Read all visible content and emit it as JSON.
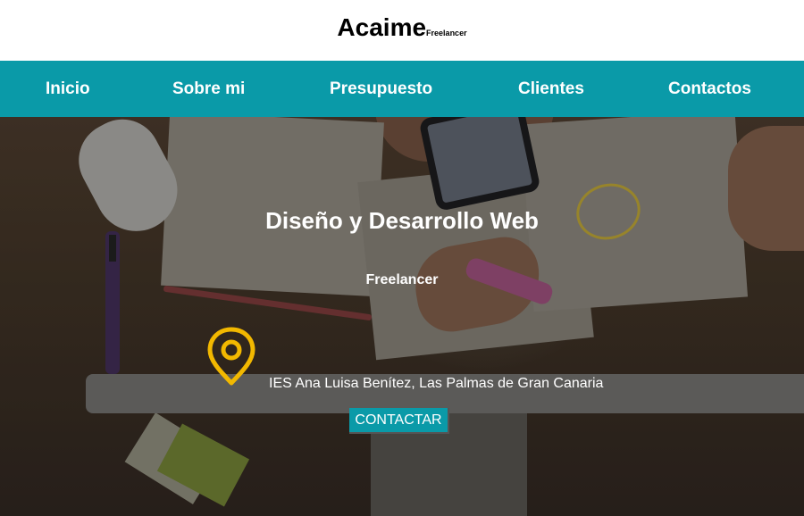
{
  "header": {
    "title": "Acaime",
    "subtitle": "Freelancer"
  },
  "nav": {
    "items": [
      {
        "label": "Inicio"
      },
      {
        "label": "Sobre mi"
      },
      {
        "label": "Presupuesto"
      },
      {
        "label": "Clientes"
      },
      {
        "label": "Contactos"
      }
    ]
  },
  "hero": {
    "title": "Diseño y Desarrollo Web",
    "subtitle": "Freelancer",
    "location_icon": "map-pin-icon",
    "address": "IES Ana Luisa Benítez, Las Palmas de Gran Canaria",
    "cta_label": "CONTACTAR"
  },
  "colors": {
    "accent": "#0a9aa8",
    "pin": "#f2b800",
    "nav_text": "#ffffff"
  }
}
